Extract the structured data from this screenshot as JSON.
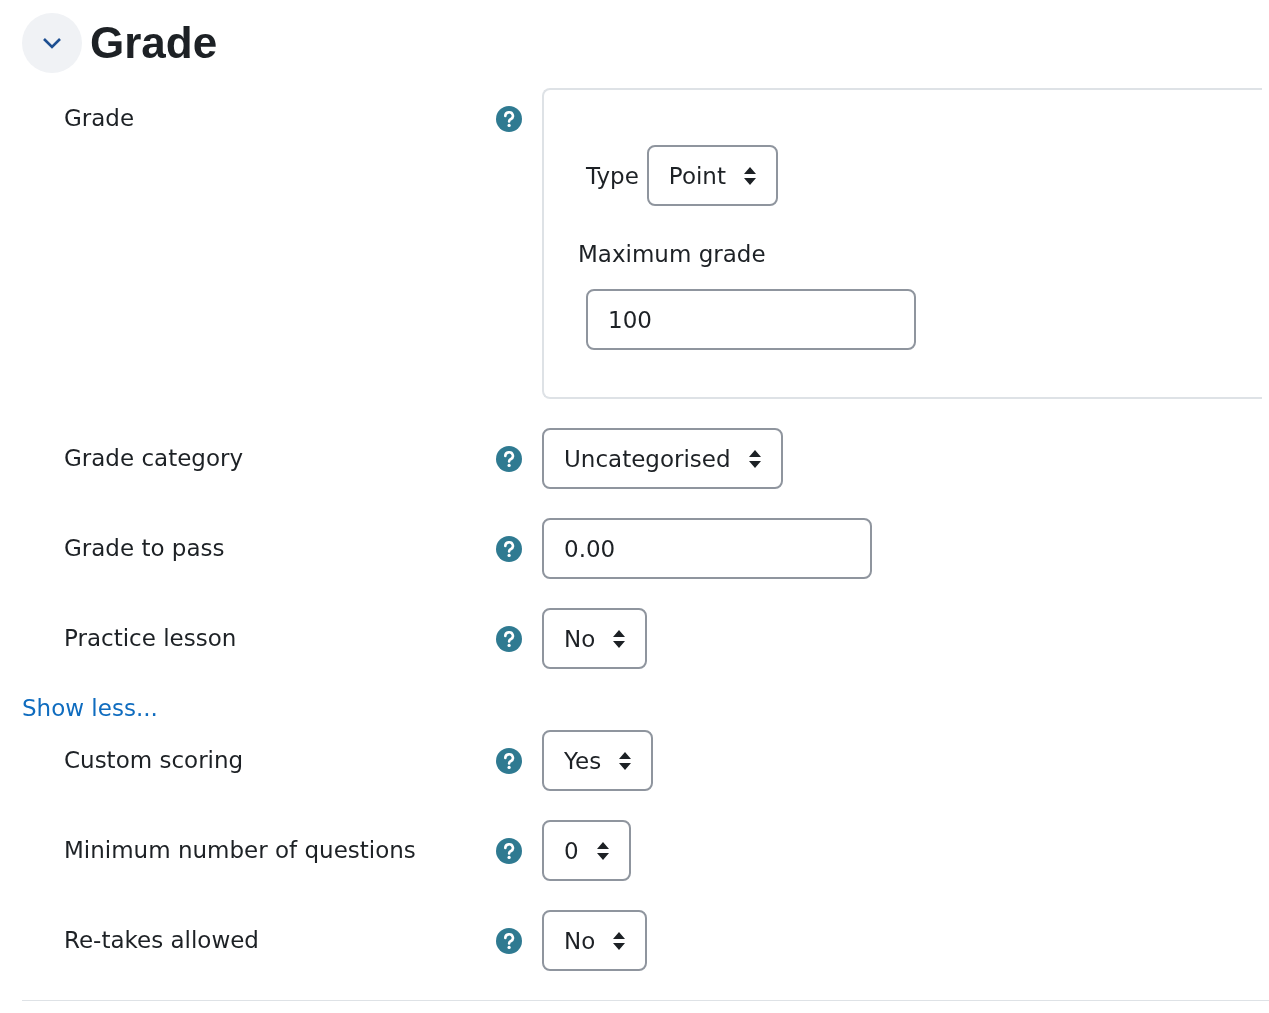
{
  "section": {
    "title": "Grade",
    "expanded": true
  },
  "rows": [
    {
      "kind": "fieldset",
      "label": "Grade",
      "type_label": "Type",
      "type_value": "Point",
      "max_label": "Maximum grade",
      "max_value": "100"
    },
    {
      "kind": "select",
      "label": "Grade category",
      "value": "Uncategorised"
    },
    {
      "kind": "input",
      "label": "Grade to pass",
      "value": "0.00"
    },
    {
      "kind": "select",
      "label": "Practice lesson",
      "value": "No"
    }
  ],
  "toggle_link": "Show less...",
  "advanced_rows": [
    {
      "kind": "select",
      "label": "Custom scoring",
      "value": "Yes"
    },
    {
      "kind": "select",
      "label": "Minimum number of questions",
      "value": "0"
    },
    {
      "kind": "select",
      "label": "Re-takes allowed",
      "value": "No"
    }
  ]
}
